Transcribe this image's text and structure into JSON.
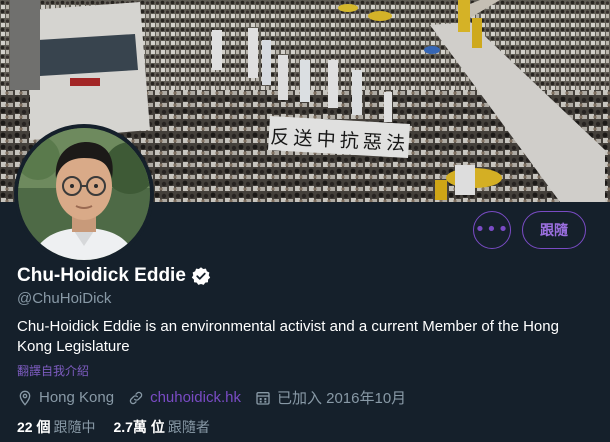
{
  "banner": {
    "protest_banner_text": "反送中抗惡法",
    "description_icon": "crowd-photo"
  },
  "profile": {
    "display_name": "Chu-Hoidick Eddie",
    "handle": "@ChuHoiDick",
    "bio": "Chu-Hoidick Eddie is an environmental activist and a current Member of the Hong Kong Legislature",
    "translate_label": "翻譯自我介紹",
    "location": "Hong Kong",
    "website": "chuhoidick.hk",
    "joined": "已加入 2016年10月"
  },
  "actions": {
    "more_label": "•••",
    "follow_label": "跟隨"
  },
  "stats": {
    "following_count": "22 個",
    "following_label": "跟隨中",
    "followers_count": "2.7萬 位",
    "followers_label": "跟隨者"
  },
  "colors": {
    "background": "#15202b",
    "accent": "#794bc4",
    "secondary_text": "#8899a6"
  }
}
